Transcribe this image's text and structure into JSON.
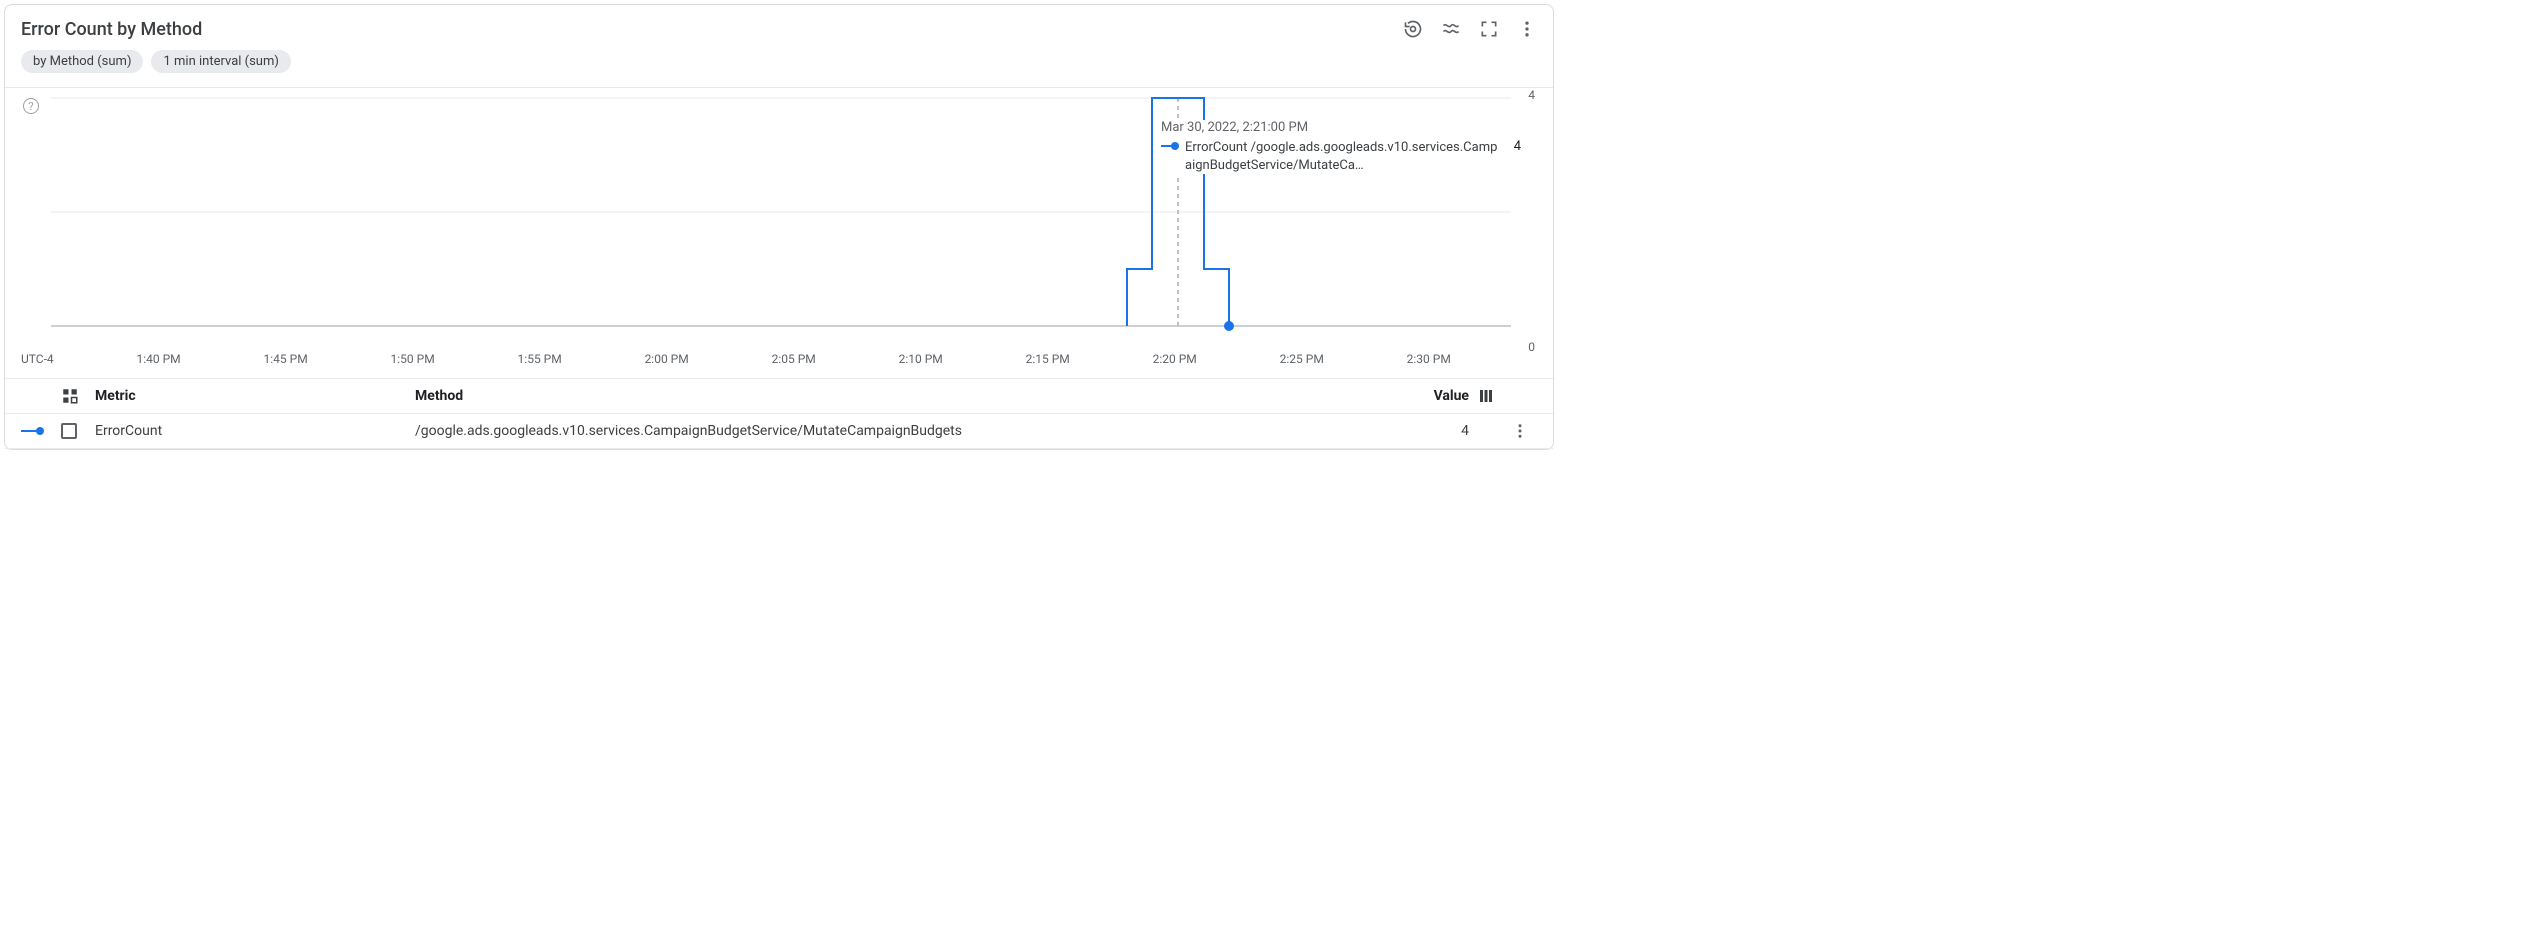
{
  "title": "Error Count by Method",
  "chips": {
    "grouping": "by Method (sum)",
    "interval": "1 min interval (sum)"
  },
  "xaxis": {
    "timezone": "UTC-4",
    "ticks": [
      "1:40 PM",
      "1:45 PM",
      "1:50 PM",
      "1:55 PM",
      "2:00 PM",
      "2:05 PM",
      "2:10 PM",
      "2:15 PM",
      "2:20 PM",
      "2:25 PM",
      "2:30 PM"
    ]
  },
  "yaxis": {
    "top": "4",
    "bottom": "0"
  },
  "tooltip": {
    "timestamp": "Mar 30, 2022, 2:21:00 PM",
    "series_label": "ErrorCount /google.ads.googleads.v10.services.CampaignBudgetService/MutateCa…",
    "value": "4"
  },
  "legend": {
    "headers": {
      "metric": "Metric",
      "method": "Method",
      "value": "Value"
    },
    "rows": [
      {
        "metric": "ErrorCount",
        "method": "/google.ads.googleads.v10.services.CampaignBudgetService/MutateCampaignBudgets",
        "value": "4",
        "color": "#1a73e8"
      }
    ]
  },
  "chart_data": {
    "type": "line",
    "title": "Error Count by Method",
    "xlabel": "",
    "ylabel": "",
    "ylim": [
      0,
      4
    ],
    "x_ticks": [
      "1:40 PM",
      "1:45 PM",
      "1:50 PM",
      "1:55 PM",
      "2:00 PM",
      "2:05 PM",
      "2:10 PM",
      "2:15 PM",
      "2:20 PM",
      "2:25 PM",
      "2:30 PM"
    ],
    "series": [
      {
        "name": "ErrorCount /google.ads.googleads.v10.services.CampaignBudgetService/MutateCampaignBudgets",
        "color": "#1a73e8",
        "points": [
          {
            "x": "2:19 PM",
            "y": 0
          },
          {
            "x": "2:20 PM",
            "y": 1
          },
          {
            "x": "2:21 PM",
            "y": 4
          },
          {
            "x": "2:22 PM",
            "y": 1
          },
          {
            "x": "2:23 PM",
            "y": 0
          }
        ]
      }
    ],
    "hover_x": "2:21 PM",
    "current_time_marker": "2:23 PM"
  }
}
